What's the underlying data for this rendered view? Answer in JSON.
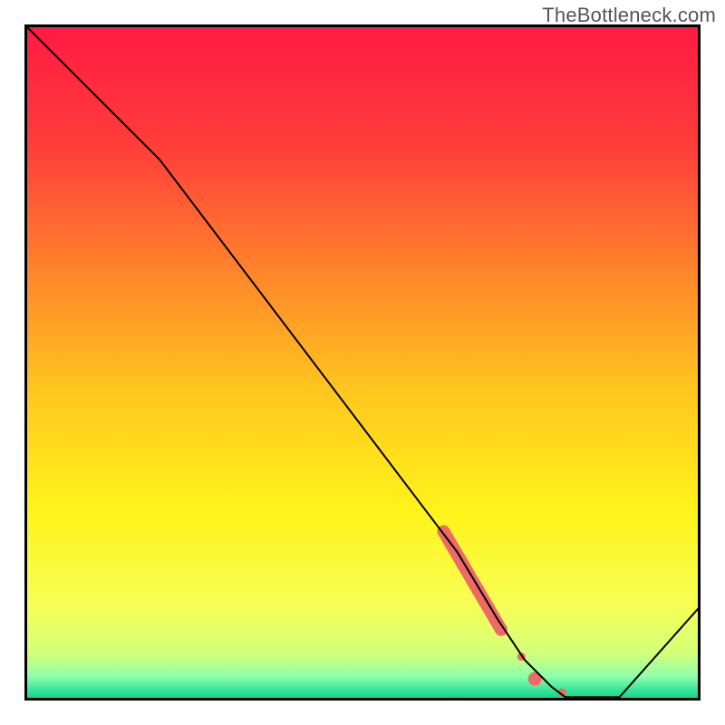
{
  "watermark": "TheBottleneck.com",
  "chart_data": {
    "type": "line",
    "title": "",
    "xlabel": "",
    "ylabel": "",
    "xlim": [
      0,
      100
    ],
    "ylim": [
      0,
      100
    ],
    "grid": false,
    "legend": false,
    "series": [
      {
        "name": "bottleneck-curve",
        "x": [
          0,
          20,
          64,
          70,
          74,
          78,
          80,
          88,
          100
        ],
        "values": [
          100,
          80,
          22,
          12,
          6,
          2,
          0.5,
          0.5,
          14
        ],
        "color": "#000000",
        "line_width": 2
      }
    ],
    "markers": [
      {
        "name": "highlight-stroke",
        "x0": 62,
        "y0": 25,
        "x1": 70.5,
        "y1": 10.5,
        "color": "#ed6a66",
        "width": 14,
        "cap": "round"
      },
      {
        "name": "dot-1",
        "cx": 73.5,
        "cy": 6.5,
        "r": 4.5,
        "color": "#ed6a66"
      },
      {
        "name": "dot-2",
        "cx": 75.5,
        "cy": 3.2,
        "r": 7.5,
        "color": "#ed6a66"
      },
      {
        "name": "dot-3",
        "cx": 79.5,
        "cy": 1.2,
        "r": 4.5,
        "color": "#ed6a66"
      }
    ],
    "background_gradient": {
      "stops": [
        {
          "offset": 0.0,
          "color": "#ff1a44"
        },
        {
          "offset": 0.18,
          "color": "#ff3d3a"
        },
        {
          "offset": 0.38,
          "color": "#ff8a2a"
        },
        {
          "offset": 0.55,
          "color": "#ffc91e"
        },
        {
          "offset": 0.72,
          "color": "#fff31a"
        },
        {
          "offset": 0.86,
          "color": "#f7ff55"
        },
        {
          "offset": 0.93,
          "color": "#d3ff7a"
        },
        {
          "offset": 0.965,
          "color": "#8cffad"
        },
        {
          "offset": 0.985,
          "color": "#33e59a"
        },
        {
          "offset": 1.0,
          "color": "#18c888"
        }
      ]
    }
  }
}
